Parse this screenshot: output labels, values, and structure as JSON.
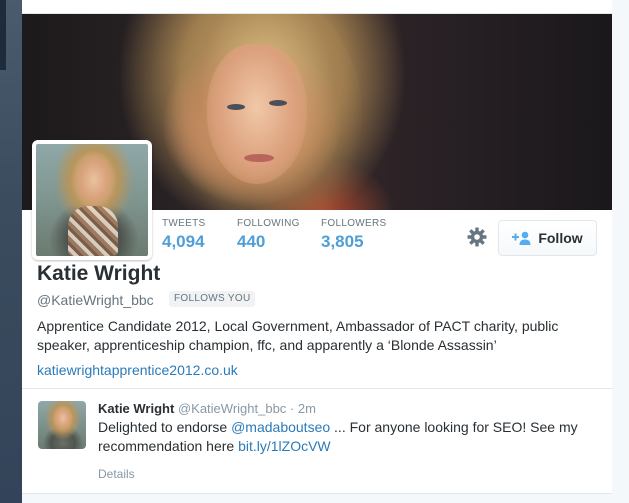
{
  "profile": {
    "name": "Katie Wright",
    "handle": "@KatieWright_bbc",
    "follows_you": "FOLLOWS YOU",
    "bio": "Apprentice Candidate 2012, Local Government, Ambassador of PACT charity, public speaker, apprenticeship champion, ffc, and apparently a ‘Blonde Assassin’",
    "website": "katiewrightapprentice2012.co.uk"
  },
  "stats": [
    {
      "label": "TWEETS",
      "value": "4,094"
    },
    {
      "label": "FOLLOWING",
      "value": "440"
    },
    {
      "label": "FOLLOWERS",
      "value": "3,805"
    }
  ],
  "actions": {
    "follow_label": "Follow",
    "settings_icon": "gear-icon",
    "follow_icon": "add-user-icon"
  },
  "tweet": {
    "name": "Katie Wright",
    "handle": "@KatieWright_bbc",
    "separator": "·",
    "time": "2m",
    "text_before": "Delighted to endorse ",
    "mention": "@madaboutseo",
    "text_middle": " ... For anyone looking for SEO! See my recommendation here ",
    "url": "bit.ly/1lZOcVW",
    "details_label": "Details"
  },
  "colors": {
    "link": "#2b7bb9",
    "stat_value": "#4f9ed8",
    "text": "#292f33",
    "muted": "#66757f"
  }
}
